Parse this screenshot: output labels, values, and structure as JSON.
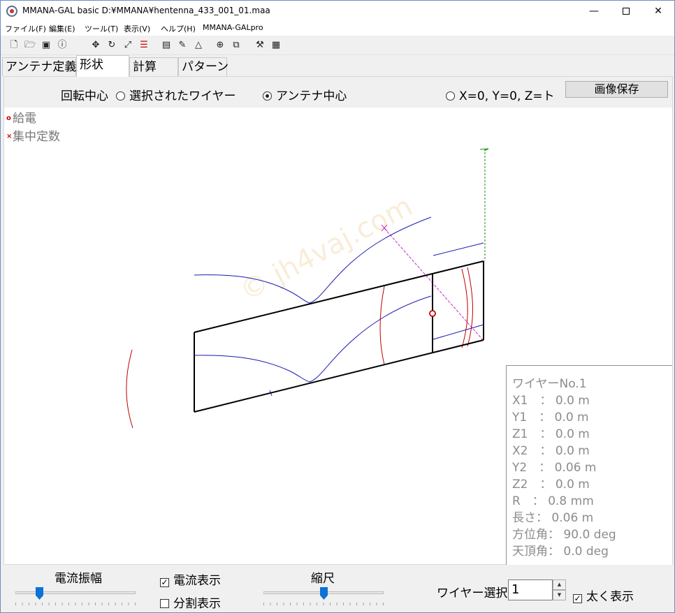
{
  "window": {
    "title": "MMANA-GAL basic  D:¥MMANA¥hentenna_433_001_01.maa",
    "minimize": "—",
    "close": "✕"
  },
  "menu": [
    "ファイル(F)",
    "編集(E)",
    "ツール(T)",
    "表示(V)",
    "ヘルプ(H)",
    "MMANA-GALpro"
  ],
  "toolbar_icons": [
    "new-file-icon",
    "open-folder-icon",
    "save-icon",
    "info-icon",
    "move-icon",
    "rotate-icon",
    "zoom-icon",
    "wire-split-icon",
    "document-icon",
    "pen-icon",
    "triangle-icon",
    "target-icon",
    "copy-icon",
    "tools-icon",
    "calculator-icon"
  ],
  "tabs": [
    {
      "label": "アンテナ定義",
      "active": false
    },
    {
      "label": "形状",
      "active": true
    },
    {
      "label": "計算",
      "active": false
    },
    {
      "label": "パターン",
      "active": false
    }
  ],
  "rotation": {
    "label": "回転中心",
    "options": [
      {
        "label": "選択されたワイヤー",
        "selected": false
      },
      {
        "label": "アンテナ中心",
        "selected": true
      },
      {
        "label": "X=0, Y=0, Z=ト",
        "selected": false
      }
    ],
    "save_button": "画像保存"
  },
  "legend": [
    {
      "marker": "○",
      "label": "給電"
    },
    {
      "marker": "×",
      "label": "集中定数"
    }
  ],
  "watermark": "© jh4vaj.com",
  "wire_info": [
    "ワイヤーNo.1",
    "X1　：  0.0 m",
    "Y1　：  0.0 m",
    "Z1　：  0.0 m",
    "X2　：  0.0 m",
    "Y2　：  0.06 m",
    "Z2　：  0.0 m",
    "R　：  0.8 mm",
    "長さ：  0.06 m",
    "方位角：  90.0 deg",
    "天頂角：  0.0 deg"
  ],
  "bottom": {
    "current_amplitude": {
      "label": "電流振幅",
      "value_fraction": 0.18
    },
    "show_current": {
      "label": "電流表示",
      "checked": true
    },
    "show_segments": {
      "label": "分割表示",
      "checked": false
    },
    "scale": {
      "label": "縮尺",
      "value_fraction": 0.5
    },
    "wire_select": {
      "label": "ワイヤー選択",
      "value": "1"
    },
    "bold_display": {
      "label": "太く表示",
      "checked": true
    }
  },
  "colors": {
    "wire": "#000000",
    "current": "#1a1ab0",
    "current_alt": "#c00000",
    "axis": "#1a8a1a",
    "selected_axis": "#cc33cc"
  }
}
